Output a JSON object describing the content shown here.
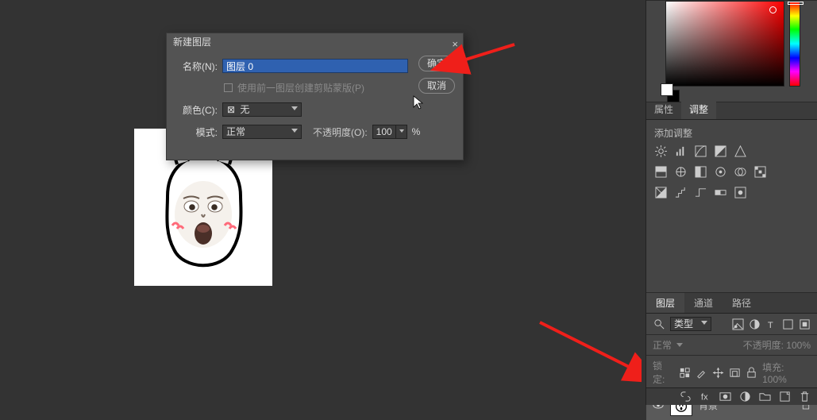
{
  "dialog": {
    "title": "新建图层",
    "name_label": "名称(N):",
    "name_value": "图层 0",
    "mask_label": "使用前一图层创建剪贴蒙版(P)",
    "color_label": "颜色(C):",
    "color_value": "无",
    "mode_label": "模式:",
    "mode_value": "正常",
    "opacity_label": "不透明度(O):",
    "opacity_value": "100",
    "opacity_unit": "%",
    "ok": "确定",
    "cancel": "取消"
  },
  "properties_panel": {
    "tab_props": "属性",
    "tab_adjust": "调整",
    "add_title": "添加调整"
  },
  "layers_panel": {
    "tab_layers": "图层",
    "tab_channels": "通道",
    "tab_paths": "路径",
    "kind": "类型",
    "blend_mode": "正常",
    "opacity_label": "不透明度:",
    "opacity_value": "100%",
    "lock_label": "锁定:",
    "fill_label": "填充:",
    "fill_value": "100%",
    "layer_name": "背景"
  }
}
